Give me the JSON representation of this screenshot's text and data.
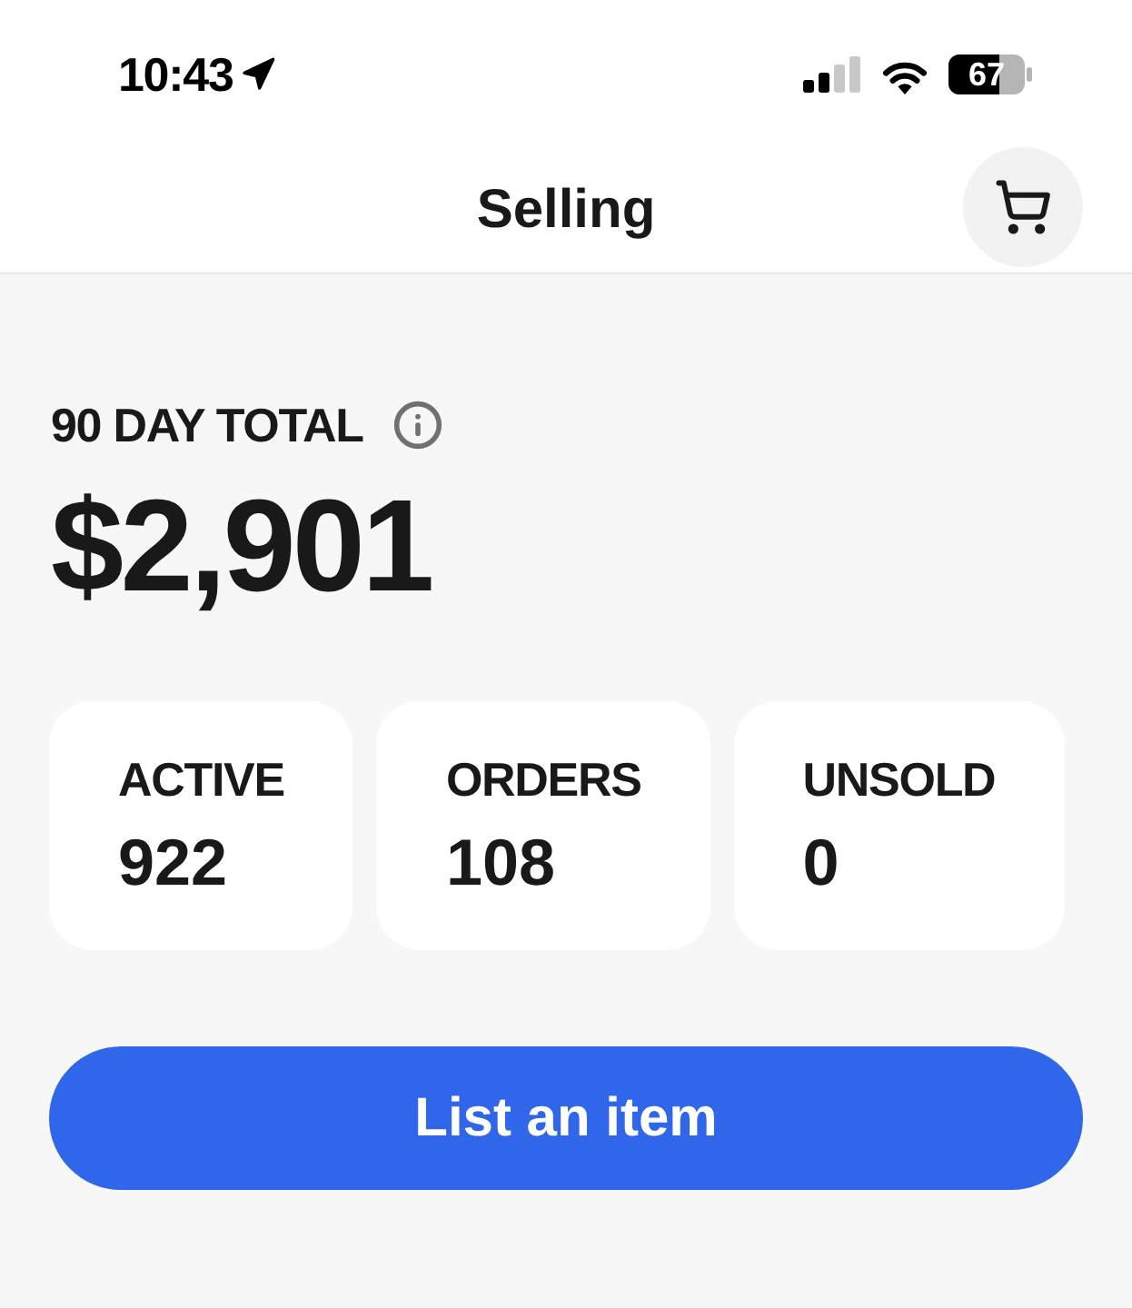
{
  "status_bar": {
    "time": "10:43",
    "battery": "67"
  },
  "nav_bar": {
    "title": "Selling"
  },
  "summary": {
    "label": "90 DAY TOTAL",
    "amount": "$2,901"
  },
  "stats": [
    {
      "label": "ACTIVE",
      "value": "922"
    },
    {
      "label": "ORDERS",
      "value": "108"
    },
    {
      "label": "UNSOLD",
      "value": "0"
    }
  ],
  "primary_button": {
    "label": "List an item"
  }
}
